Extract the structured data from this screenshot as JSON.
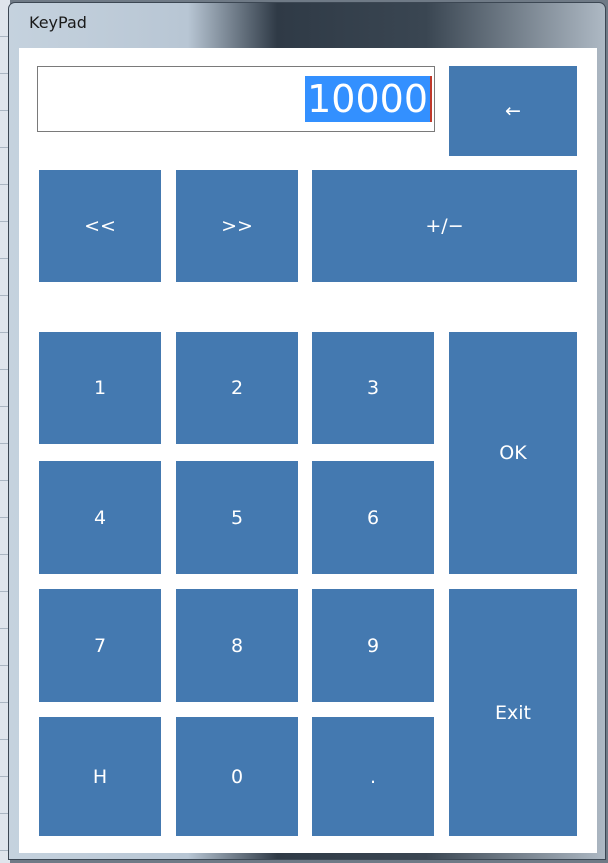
{
  "window": {
    "title": "KeyPad"
  },
  "display": {
    "value": "10000"
  },
  "keys": {
    "backspace": "←",
    "left": "<<",
    "right": ">>",
    "sign": "+/−",
    "k1": "1",
    "k2": "2",
    "k3": "3",
    "k4": "4",
    "k5": "5",
    "k6": "6",
    "k7": "7",
    "k8": "8",
    "k9": "9",
    "h": "H",
    "k0": "0",
    "dot": ".",
    "ok": "OK",
    "exit": "Exit"
  },
  "colors": {
    "key": "#4479b0",
    "selection": "#3390ff"
  }
}
